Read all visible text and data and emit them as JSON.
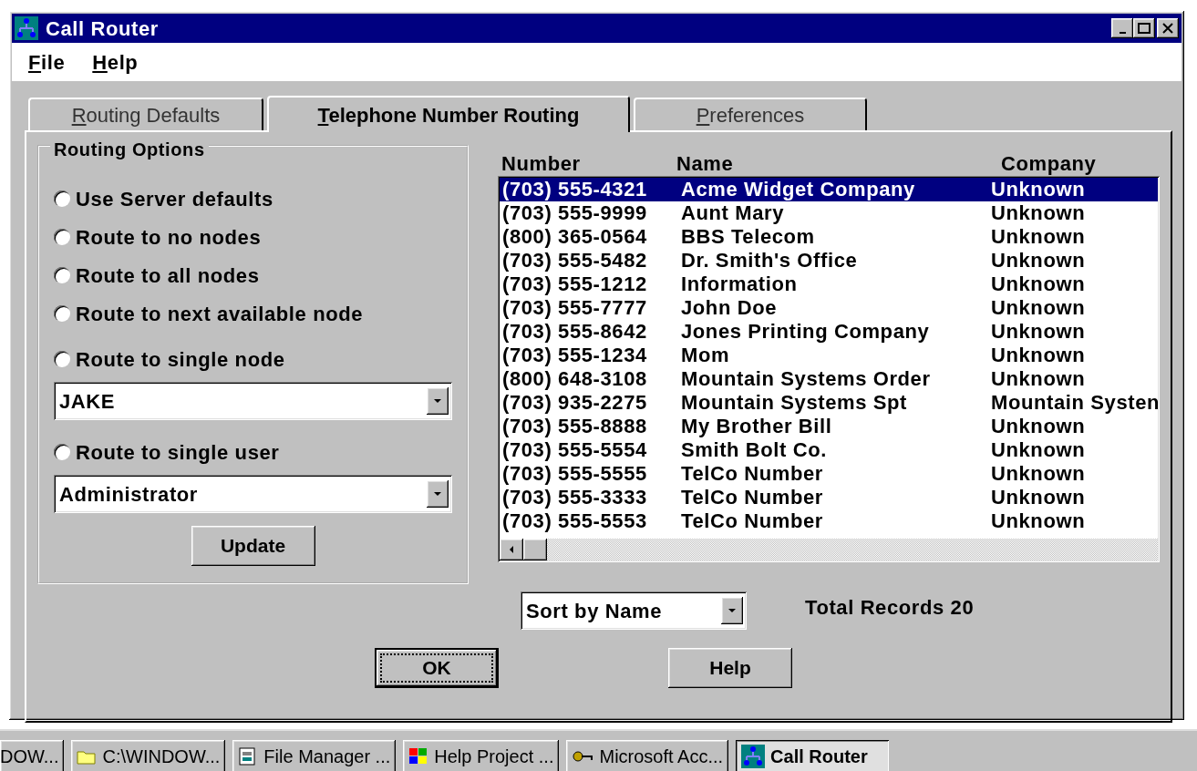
{
  "window": {
    "title": "Call Router"
  },
  "menu": [
    {
      "label": "File"
    },
    {
      "label": "Help"
    }
  ],
  "tabs": [
    {
      "label": "Routing Defaults",
      "selected": false
    },
    {
      "label": "Telephone Number Routing",
      "selected": true
    },
    {
      "label": "Preferences",
      "selected": false
    }
  ],
  "routing_options": {
    "title": "Routing Options",
    "items": [
      {
        "kind": "radio",
        "label": "Use Server defaults",
        "checked": false
      },
      {
        "kind": "radio",
        "label": "Route to no nodes",
        "checked": false
      },
      {
        "kind": "radio",
        "label": "Route to all nodes",
        "checked": false
      },
      {
        "kind": "radio",
        "label": "Route to next available node",
        "checked": false
      },
      {
        "kind": "radio",
        "label": "Route to single node",
        "checked": false
      },
      {
        "kind": "dropdown",
        "value": "JAKE"
      },
      {
        "kind": "radio",
        "label": "Route to single user",
        "checked": false
      },
      {
        "kind": "dropdown",
        "value": "Administrator"
      },
      {
        "kind": "button",
        "label": "Update"
      }
    ]
  },
  "phone_list": {
    "columns": [
      "Number",
      "Name",
      "Company"
    ],
    "rows": [
      {
        "number": "(703) 555-4321",
        "name": "Acme Widget Company",
        "company": "Unknown",
        "selected": true
      },
      {
        "number": "(703) 555-9999",
        "name": "Aunt Mary",
        "company": "Unknown",
        "selected": false
      },
      {
        "number": "(800) 365-0564",
        "name": "BBS Telecom",
        "company": "Unknown",
        "selected": false
      },
      {
        "number": "(703) 555-5482",
        "name": "Dr. Smith's Office",
        "company": "Unknown",
        "selected": false
      },
      {
        "number": "(703) 555-1212",
        "name": "Information",
        "company": "Unknown",
        "selected": false
      },
      {
        "number": "(703) 555-7777",
        "name": "John Doe",
        "company": "Unknown",
        "selected": false
      },
      {
        "number": "(703) 555-8642",
        "name": "Jones Printing Company",
        "company": "Unknown",
        "selected": false
      },
      {
        "number": "(703) 555-1234",
        "name": "Mom",
        "company": "Unknown",
        "selected": false
      },
      {
        "number": "(800) 648-3108",
        "name": "Mountain Systems Order",
        "company": "Unknown",
        "selected": false
      },
      {
        "number": "(703) 935-2275",
        "name": "Mountain Systems Spt",
        "company": "Mountain Systen",
        "selected": false
      },
      {
        "number": "(703) 555-8888",
        "name": "My Brother Bill",
        "company": "Unknown",
        "selected": false
      },
      {
        "number": "(703) 555-5554",
        "name": "Smith Bolt Co.",
        "company": "Unknown",
        "selected": false
      },
      {
        "number": "(703) 555-5555",
        "name": "TelCo Number",
        "company": "Unknown",
        "selected": false
      },
      {
        "number": "(703) 555-3333",
        "name": "TelCo Number",
        "company": "Unknown",
        "selected": false
      },
      {
        "number": "(703) 555-5553",
        "name": "TelCo Number",
        "company": "Unknown",
        "selected": false
      }
    ]
  },
  "sort_dropdown": {
    "value": "Sort by Name"
  },
  "total_records": "Total Records 20",
  "buttons": [
    {
      "label": "OK",
      "focused": true
    },
    {
      "label": "Help",
      "focused": false
    }
  ],
  "taskbar": [
    {
      "label": "DOW...",
      "selected": false
    },
    {
      "label": "C:\\WINDOW...",
      "selected": false
    },
    {
      "label": "File Manager ...",
      "selected": false
    },
    {
      "label": "Help Project ...",
      "selected": false
    },
    {
      "label": "Microsoft Acc...",
      "selected": false
    },
    {
      "label": "Call Router",
      "selected": true
    }
  ]
}
